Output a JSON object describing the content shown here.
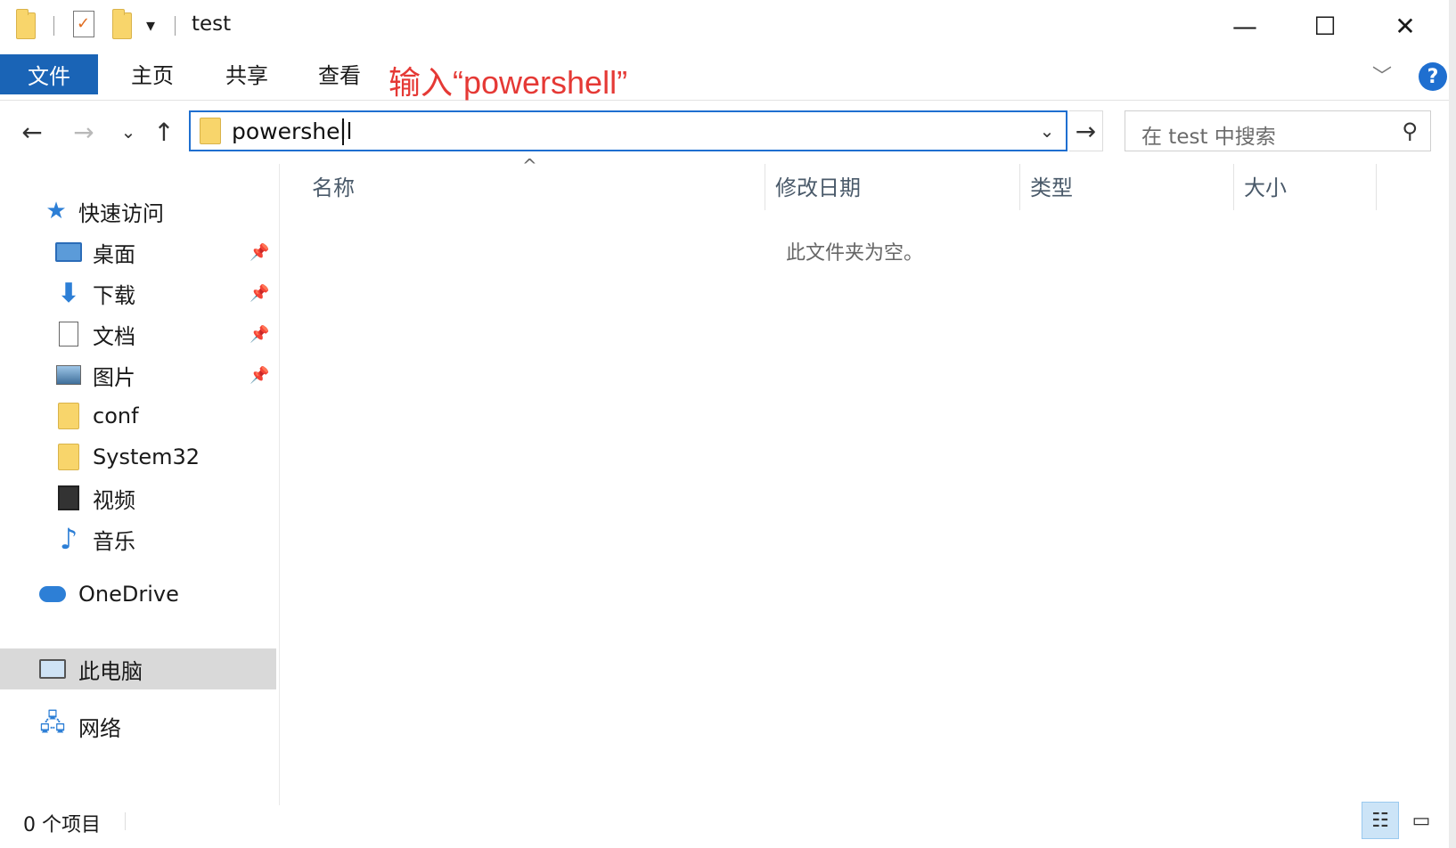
{
  "window": {
    "title": "test",
    "minimize_glyph": "—",
    "maximize_glyph": "☐",
    "close_glyph": "✕",
    "qat_dropdown_glyph": "▾"
  },
  "ribbon": {
    "tabs": [
      {
        "label": "文件"
      },
      {
        "label": "主页"
      },
      {
        "label": "共享"
      },
      {
        "label": "查看"
      }
    ],
    "annotation": "输入“powershell”",
    "expand_glyph": "﹀",
    "help_glyph": "?",
    "file_tab_color": "#1a64b6",
    "annotation_color": "#e53935"
  },
  "address_bar": {
    "back_glyph": "←",
    "forward_glyph": "→",
    "recent_glyph": "⌄",
    "up_glyph": "↑",
    "value": "powershell",
    "dropdown_glyph": "⌄",
    "go_glyph": "→",
    "search_placeholder": "在 test 中搜索",
    "search_glyph": "⚲"
  },
  "nav_pane": {
    "quick_access": {
      "label": "快速访问",
      "icon": "star-icon"
    },
    "items": [
      {
        "label": "桌面",
        "icon": "desktop-icon",
        "pinned": true
      },
      {
        "label": "下载",
        "icon": "download-icon",
        "pinned": true
      },
      {
        "label": "文档",
        "icon": "document-icon",
        "pinned": true
      },
      {
        "label": "图片",
        "icon": "picture-icon",
        "pinned": true
      },
      {
        "label": "conf",
        "icon": "folder-icon",
        "pinned": false
      },
      {
        "label": "System32",
        "icon": "folder-icon",
        "pinned": false
      },
      {
        "label": "视频",
        "icon": "video-icon",
        "pinned": false
      },
      {
        "label": "音乐",
        "icon": "music-icon",
        "pinned": false
      }
    ],
    "onedrive": {
      "label": "OneDrive",
      "icon": "onedrive-icon"
    },
    "this_pc": {
      "label": "此电脑",
      "icon": "computer-icon",
      "selected": true
    },
    "network": {
      "label": "网络",
      "icon": "network-icon"
    },
    "pin_glyph": "📌"
  },
  "content": {
    "columns": [
      {
        "label": "名称"
      },
      {
        "label": "修改日期"
      },
      {
        "label": "类型"
      },
      {
        "label": "大小"
      }
    ],
    "sort_glyph": "^",
    "empty_message": "此文件夹为空。"
  },
  "status_bar": {
    "item_count": "0 个项目",
    "details_view_glyph": "☷",
    "large_icons_view_glyph": "▭"
  }
}
